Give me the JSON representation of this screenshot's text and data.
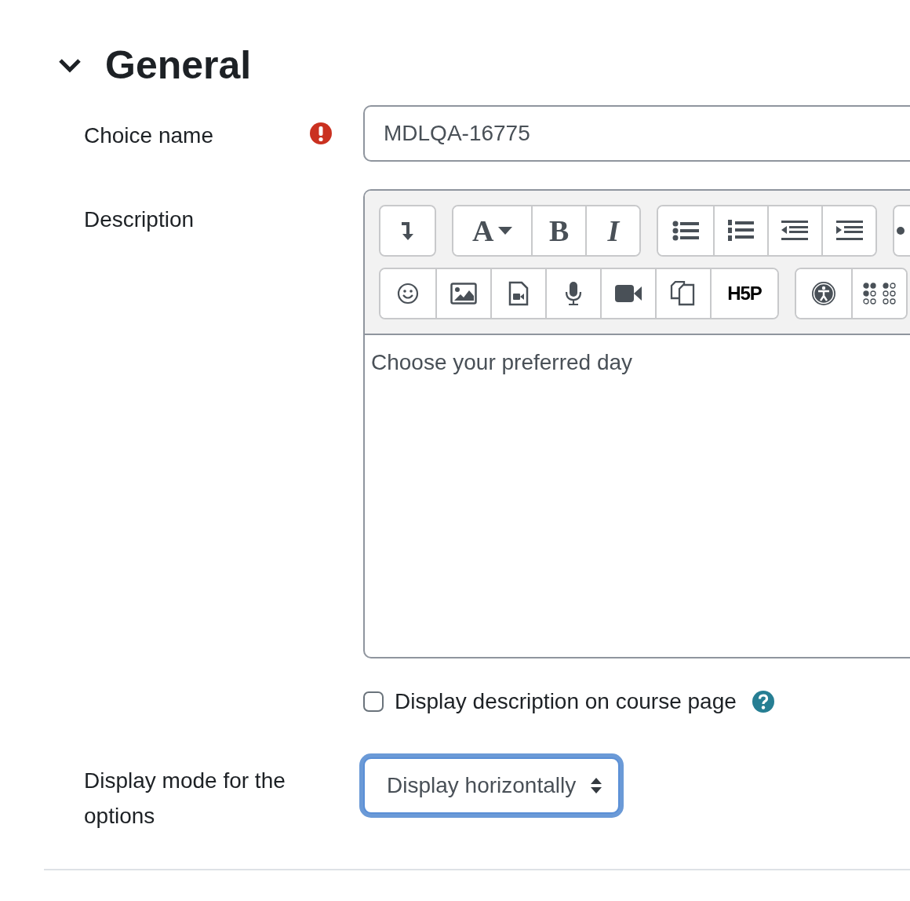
{
  "section": {
    "title": "General",
    "expanded": true
  },
  "fields": [
    {
      "kind": "text",
      "label": "Choice name",
      "required": true,
      "value": "MDLQA-16775"
    },
    {
      "kind": "editor",
      "label": "Description",
      "toolbar_labels": [
        "A",
        "B",
        "I",
        "H5P"
      ],
      "content": "Choose your preferred day"
    },
    {
      "kind": "checkbox",
      "label": "Display description on course page",
      "checked": false,
      "help": true
    },
    {
      "kind": "select",
      "label": "Display mode for the options",
      "value": "Display horizontally",
      "focused": true
    }
  ]
}
